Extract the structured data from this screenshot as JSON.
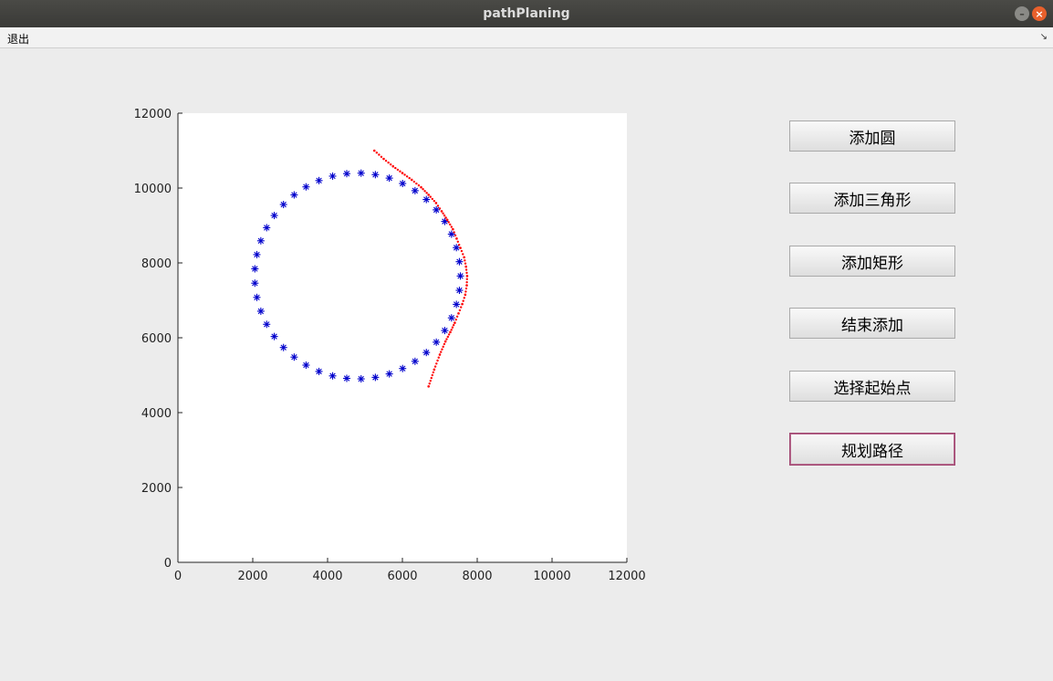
{
  "window": {
    "title": "pathPlaning",
    "controls": [
      {
        "name": "minimize",
        "icon": "minimize-icon",
        "glyph": "–"
      },
      {
        "name": "close",
        "icon": "close-icon",
        "glyph": "×"
      }
    ]
  },
  "menubar": {
    "items": [
      {
        "label": "退出"
      }
    ],
    "dock_icon": "↘"
  },
  "buttons": [
    {
      "label": "添加圆"
    },
    {
      "label": "添加三角形"
    },
    {
      "label": "添加矩形"
    },
    {
      "label": "结束添加"
    },
    {
      "label": "选择起始点"
    },
    {
      "label": "规划路径",
      "focused": true
    }
  ],
  "chart_data": {
    "type": "scatter",
    "xlim": [
      0,
      12000
    ],
    "ylim": [
      0,
      12000
    ],
    "xticks": [
      "0",
      "2000",
      "4000",
      "6000",
      "8000",
      "10000",
      "12000"
    ],
    "yticks": [
      "0",
      "2000",
      "4000",
      "6000",
      "8000",
      "10000",
      "12000"
    ],
    "grid": false,
    "series": [
      {
        "marker": "asterisk",
        "color": "#0000cc",
        "circle": {
          "center": [
            4800,
            7650
          ],
          "radius": 2750,
          "points": 45
        }
      },
      {
        "marker": "dot",
        "color": "#ff0000",
        "x": [
          5250,
          5500,
          5750,
          6000,
          6250,
          6500,
          6700,
          6900,
          7050,
          7200,
          7350,
          7450,
          7550,
          7650,
          7700,
          7730,
          7720,
          7680,
          7600,
          7500,
          7400,
          7280,
          7150,
          7000,
          6850,
          6700
        ],
        "y": [
          11000,
          10780,
          10580,
          10400,
          10220,
          10020,
          9820,
          9600,
          9380,
          9150,
          8900,
          8650,
          8400,
          8150,
          7900,
          7650,
          7400,
          7150,
          6900,
          6650,
          6400,
          6150,
          5900,
          5550,
          5150,
          4700
        ]
      }
    ]
  }
}
